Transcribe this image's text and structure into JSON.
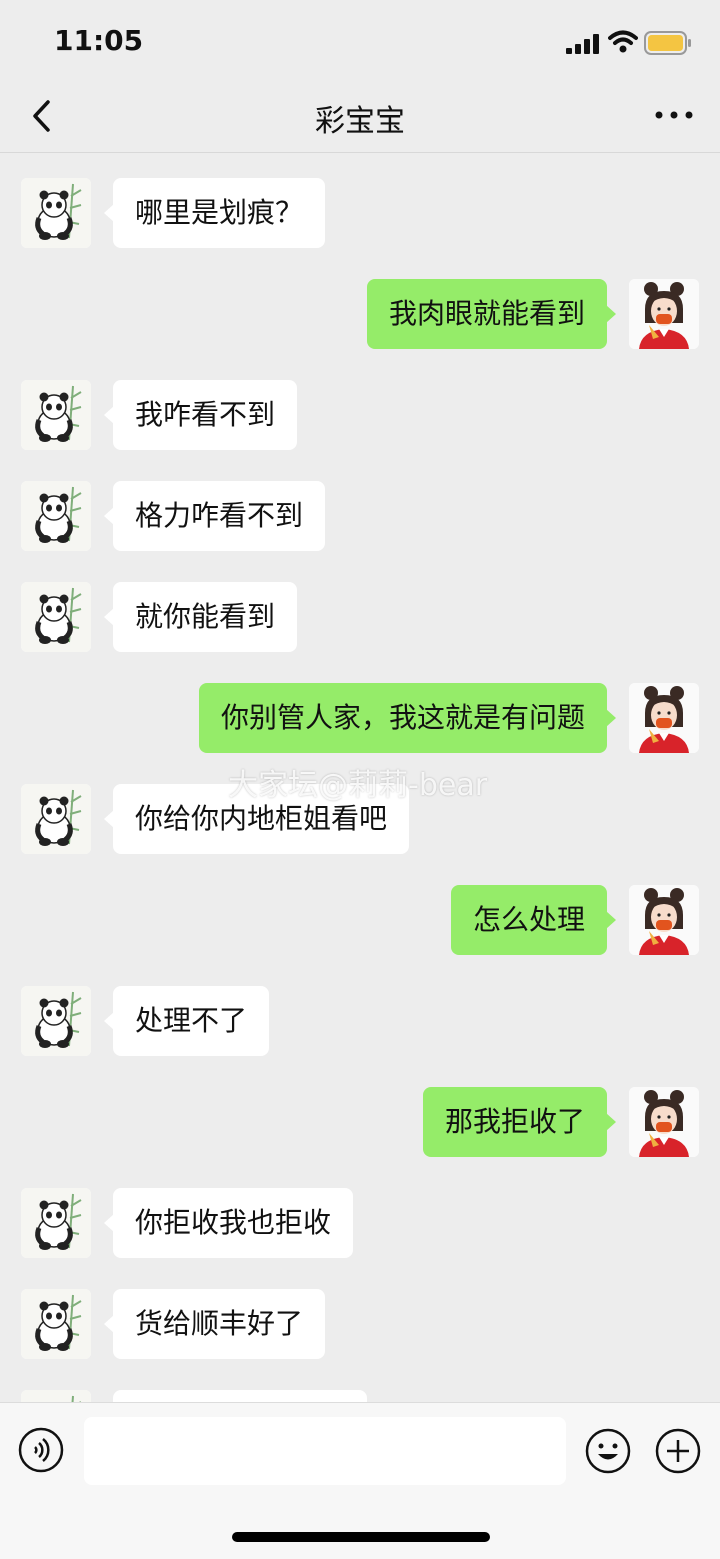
{
  "status": {
    "time": "11:05"
  },
  "header": {
    "title": "彩宝宝"
  },
  "watermark": "大家坛@莉莉-bear",
  "messages": [
    {
      "side": "in",
      "text": "哪里是划痕？"
    },
    {
      "side": "out",
      "text": "我肉眼就能看到"
    },
    {
      "side": "in",
      "text": "我咋看不到"
    },
    {
      "side": "in",
      "text": "格力咋看不到"
    },
    {
      "side": "in",
      "text": "就你能看到"
    },
    {
      "side": "out",
      "text": "你别管人家，我这就是有问题"
    },
    {
      "side": "in",
      "text": "你给你内地柜姐看吧"
    },
    {
      "side": "out",
      "text": "怎么处理"
    },
    {
      "side": "in",
      "text": "处理不了"
    },
    {
      "side": "out",
      "text": "那我拒收了"
    },
    {
      "side": "in",
      "text": "你拒收我也拒收"
    },
    {
      "side": "in",
      "text": "货给顺丰好了"
    },
    {
      "side": "in",
      "text": ""
    }
  ],
  "colors": {
    "out_bubble": "#95ec69",
    "in_bubble": "#ffffff",
    "background": "#ededed"
  },
  "icons": [
    "back-icon",
    "more-icon",
    "voice-icon",
    "emoji-icon",
    "plus-icon",
    "signal-icon",
    "wifi-icon",
    "battery-icon"
  ]
}
